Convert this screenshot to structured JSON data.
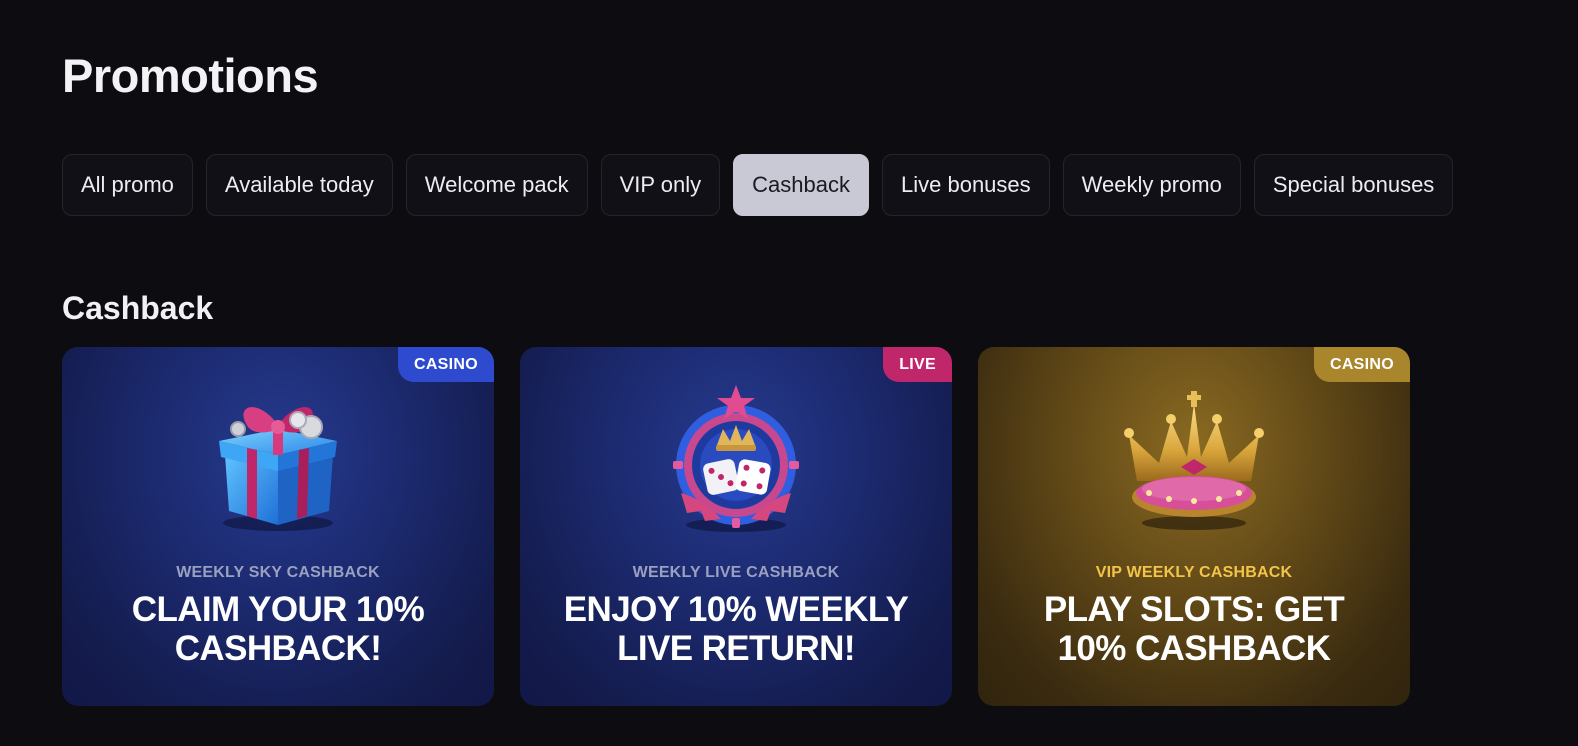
{
  "page": {
    "title": "Promotions"
  },
  "filters": [
    {
      "label": "All promo",
      "active": false
    },
    {
      "label": "Available today",
      "active": false
    },
    {
      "label": "Welcome pack",
      "active": false
    },
    {
      "label": "VIP only",
      "active": false
    },
    {
      "label": "Cashback",
      "active": true
    },
    {
      "label": "Live bonuses",
      "active": false
    },
    {
      "label": "Weekly promo",
      "active": false
    },
    {
      "label": "Special bonuses",
      "active": false
    }
  ],
  "section": {
    "title": "Cashback"
  },
  "cards": [
    {
      "badge": "CASINO",
      "subtitle": "WEEKLY SKY CASHBACK",
      "headline_line1": "CLAIM YOUR 10%",
      "headline_line2": "CASHBACK!",
      "icon": "gift-box-icon",
      "theme_color": "#1c2a70"
    },
    {
      "badge": "LIVE",
      "subtitle": "WEEKLY LIVE CASHBACK",
      "headline_line1": "ENJOY 10% WEEKLY",
      "headline_line2": "LIVE RETURN!",
      "icon": "dice-crown-emblem-icon",
      "theme_color": "#1c2a70"
    },
    {
      "badge": "CASINO",
      "subtitle": "VIP WEEKLY CASHBACK",
      "headline_line1": "PLAY SLOTS: GET",
      "headline_line2": "10% CASHBACK",
      "icon": "crown-icon",
      "theme_color": "#5e4616"
    }
  ],
  "colors": {
    "background": "#0c0c11",
    "active_chip": "#c9c9d6",
    "badge_casino_blue": "#2e4bd0",
    "badge_live": "#c0266a",
    "badge_casino_gold": "#a9852c",
    "vip_subtitle": "#f2c54a"
  }
}
